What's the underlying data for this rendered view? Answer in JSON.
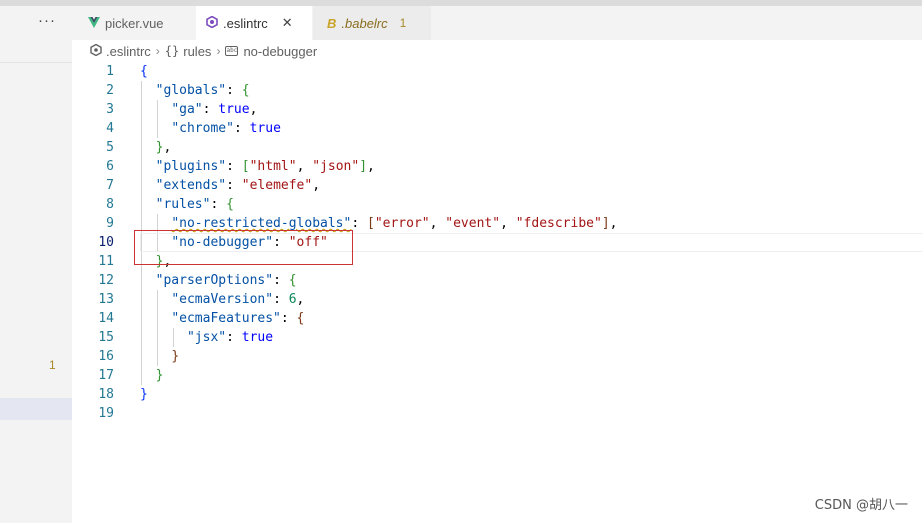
{
  "sidebar": {
    "more_label": "···",
    "problem_count": "1"
  },
  "tabs": [
    {
      "label": "picker.vue",
      "icon": "vue-icon"
    },
    {
      "label": ".eslintrc",
      "icon": "eslint-icon",
      "close": "✕"
    },
    {
      "label": ".babelrc",
      "icon": "babel-icon",
      "problems": "1"
    }
  ],
  "breadcrumb": {
    "file": ".eslintrc",
    "braces": "{}",
    "section": "rules",
    "item": "no-debugger"
  },
  "editor": {
    "line_numbers": [
      "1",
      "2",
      "3",
      "4",
      "5",
      "6",
      "7",
      "8",
      "9",
      "10",
      "11",
      "12",
      "13",
      "14",
      "15",
      "16",
      "17",
      "18",
      "19"
    ],
    "current_line": "10",
    "tokens": {
      "globals": "\"globals\"",
      "ga": "\"ga\"",
      "chrome": "\"chrome\"",
      "true": "true",
      "plugins": "\"plugins\"",
      "html": "\"html\"",
      "json": "\"json\"",
      "extends": "\"extends\"",
      "elemefe": "\"elemefe\"",
      "rules": "\"rules\"",
      "no_restricted_globals": "\"no-restricted-globals\"",
      "error": "\"error\"",
      "event": "\"event\"",
      "fdescribe": "\"fdescribe\"",
      "no_debugger": "\"no-debugger\"",
      "off": "\"off\"",
      "parserOptions": "\"parserOptions\"",
      "ecmaVersion": "\"ecmaVersion\"",
      "six": "6",
      "ecmaFeatures": "\"ecmaFeatures\"",
      "jsx": "\"jsx\""
    }
  },
  "watermark": "CSDN @胡八一"
}
